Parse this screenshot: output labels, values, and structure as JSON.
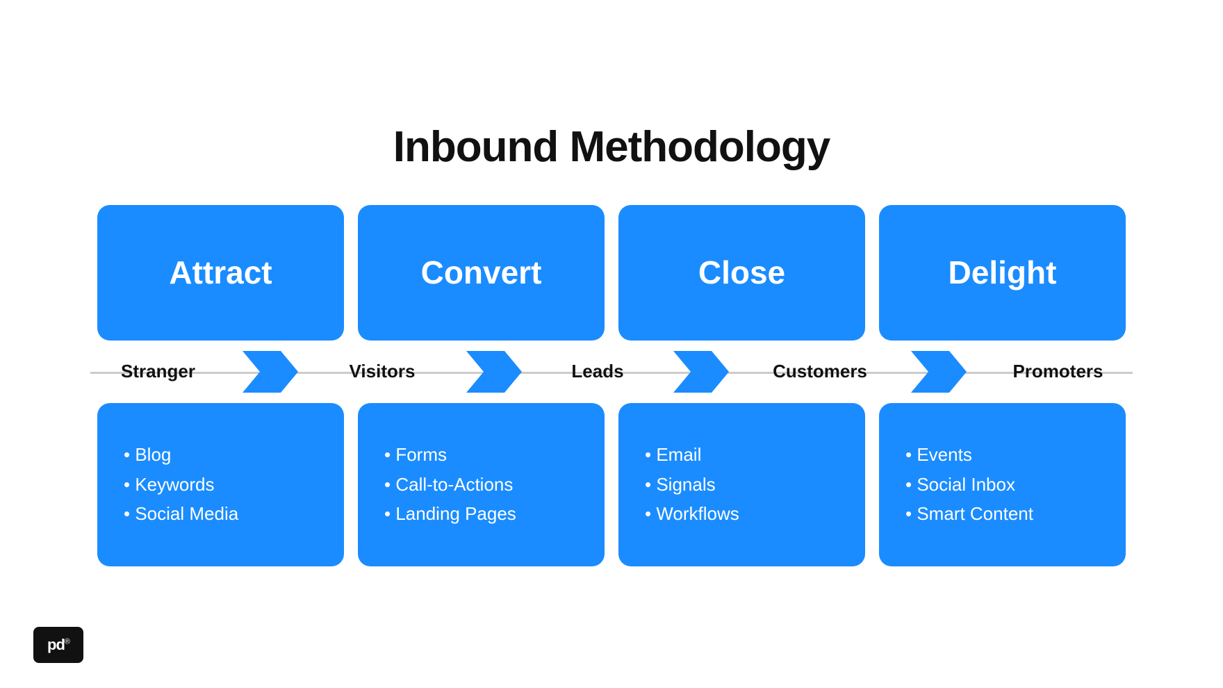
{
  "title": "Inbound Methodology",
  "colors": {
    "blue": "#1a8cff",
    "dark": "#111111",
    "white": "#ffffff"
  },
  "top_boxes": [
    {
      "id": "attract",
      "label": "Attract"
    },
    {
      "id": "convert",
      "label": "Convert"
    },
    {
      "id": "close",
      "label": "Close"
    },
    {
      "id": "delight",
      "label": "Delight"
    }
  ],
  "stages": [
    {
      "id": "stranger",
      "label": "Stranger"
    },
    {
      "id": "visitors",
      "label": "Visitors"
    },
    {
      "id": "leads",
      "label": "Leads"
    },
    {
      "id": "customers",
      "label": "Customers"
    },
    {
      "id": "promoters",
      "label": "Promoters"
    }
  ],
  "bottom_boxes": [
    {
      "id": "attract-tools",
      "items": [
        "Blog",
        "Keywords",
        "Social Media"
      ]
    },
    {
      "id": "convert-tools",
      "items": [
        "Forms",
        "Call-to-Actions",
        "Landing Pages"
      ]
    },
    {
      "id": "close-tools",
      "items": [
        "Email",
        "Signals",
        "Workflows"
      ]
    },
    {
      "id": "delight-tools",
      "items": [
        "Events",
        "Social Inbox",
        "Smart Content"
      ]
    }
  ],
  "logo": {
    "text": "pd",
    "reg": "®"
  }
}
